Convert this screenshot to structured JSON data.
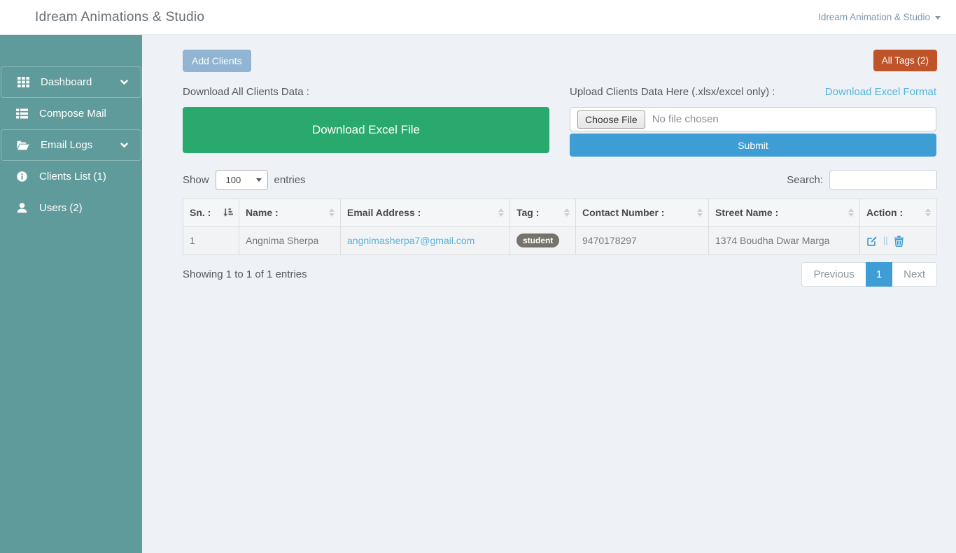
{
  "header": {
    "title": "Idream Animations & Studio",
    "account_menu_label": "Idream Animation & Studio"
  },
  "sidebar": {
    "items": [
      {
        "label": "Dashboard",
        "icon": "th-grid-icon",
        "expandable": true
      },
      {
        "label": "Compose Mail",
        "icon": "list-icon",
        "expandable": false
      },
      {
        "label": "Email Logs",
        "icon": "folder-open-icon",
        "expandable": true
      },
      {
        "label": "Clients List (1)",
        "icon": "info-circle-icon",
        "expandable": false
      },
      {
        "label": "Users (2)",
        "icon": "user-icon",
        "expandable": false
      }
    ]
  },
  "toolbar": {
    "add_clients_label": "Add Clients",
    "all_tags_label": "All Tags (2)"
  },
  "download_section": {
    "label": "Download All Clients Data :",
    "button_label": "Download Excel File"
  },
  "upload_section": {
    "label": "Upload Clients Data Here (.xlsx/excel only) :",
    "format_link_label": "Download Excel Format",
    "choose_file_label": "Choose File",
    "file_status_text": "No file chosen",
    "submit_label": "Submit"
  },
  "table_controls": {
    "show_label": "Show",
    "page_length": "100",
    "entries_label": "entries",
    "search_label": "Search:",
    "search_value": ""
  },
  "table": {
    "columns": [
      "Sn. :",
      "Name :",
      "Email Address :",
      "Tag :",
      "Contact Number :",
      "Street Name :",
      "Action :"
    ],
    "sorted_column": "Sn. :",
    "rows": [
      {
        "sn": "1",
        "name": "Angnima Sherpa",
        "email": "angnimasherpa7@gmail.com",
        "tag": "student",
        "contact_number": "9470178297",
        "street_name": "1374 Boudha Dwar Marga",
        "action_separator": "||"
      }
    ]
  },
  "table_footer": {
    "summary": "Showing 1 to 1 of 1 entries",
    "pagination": {
      "previous_label": "Previous",
      "current_page": "1",
      "next_label": "Next"
    }
  },
  "colors": {
    "sidebar_teal": "#609b9b",
    "page_background": "#eef2f6",
    "add_clients_blue": "#90b4d2",
    "all_tags_orange": "#bf5329",
    "download_green": "#29a96e",
    "submit_blue": "#3e9dd4",
    "link_blue": "#56b5da",
    "tag_badge_gray": "#76736c"
  }
}
